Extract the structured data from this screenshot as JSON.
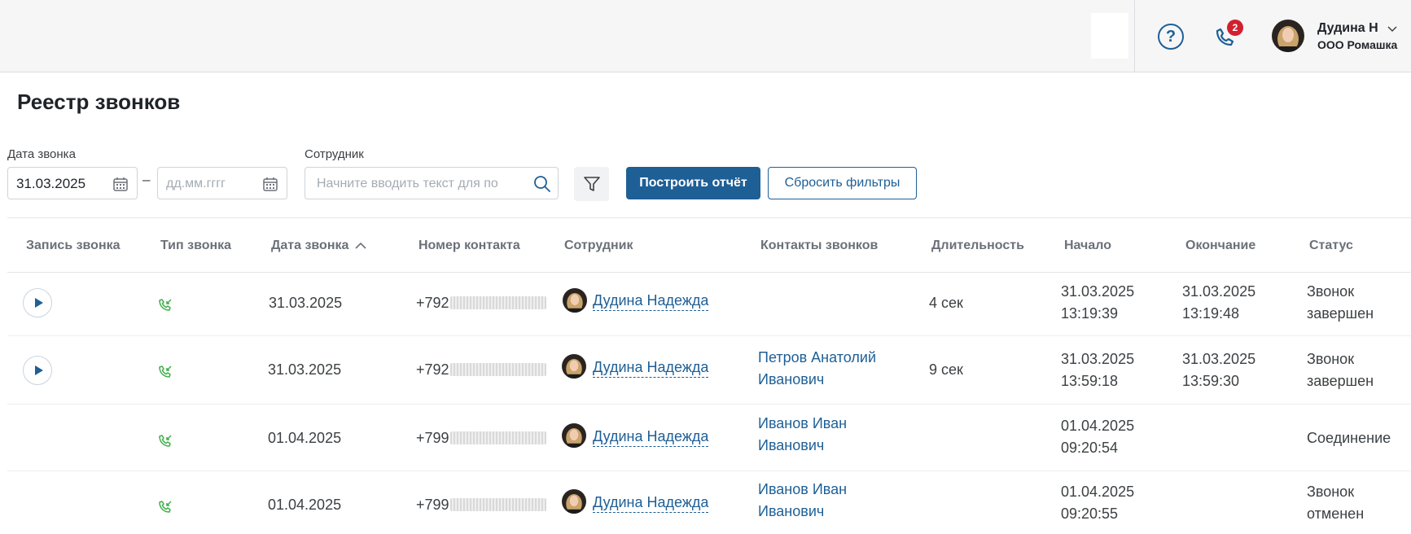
{
  "header": {
    "help_label": "?",
    "notifications_count": "2",
    "user_name": "Дудина Н",
    "user_org": "ООО Ромашка"
  },
  "page": {
    "title": "Реестр звонков"
  },
  "filters": {
    "date_label": "Дата звонка",
    "date_from": "31.03.2025",
    "date_to_placeholder": "дд.мм.гггг",
    "date_separator": "–",
    "employee_label": "Сотрудник",
    "employee_placeholder": "Начните вводить текст для по",
    "build_report": "Построить отчёт",
    "reset_filters": "Сбросить фильтры"
  },
  "table": {
    "columns": [
      "Запись звонка",
      "Тип звонка",
      "Дата звонка",
      "Номер контакта",
      "Сотрудник",
      "Контакты звонков",
      "Длительность",
      "Начало",
      "Окончание",
      "Статус"
    ],
    "rows": [
      {
        "has_record": true,
        "date": "31.03.2025",
        "phone_prefix": "+792",
        "employee": "Дудина Надежда",
        "contact_line1": "",
        "contact_line2": "",
        "duration": "4 сек",
        "start_date": "31.03.2025",
        "start_time": "13:19:39",
        "end_date": "31.03.2025",
        "end_time": "13:19:48",
        "status_line1": "Звонок",
        "status_line2": "завершен"
      },
      {
        "has_record": true,
        "date": "31.03.2025",
        "phone_prefix": "+792",
        "employee": "Дудина Надежда",
        "contact_line1": "Петров Анатолий",
        "contact_line2": "Иванович",
        "duration": "9 сек",
        "start_date": "31.03.2025",
        "start_time": "13:59:18",
        "end_date": "31.03.2025",
        "end_time": "13:59:30",
        "status_line1": "Звонок",
        "status_line2": "завершен"
      },
      {
        "has_record": false,
        "date": "01.04.2025",
        "phone_prefix": "+799",
        "employee": "Дудина Надежда",
        "contact_line1": "Иванов Иван",
        "contact_line2": "Иванович",
        "duration": "",
        "start_date": "01.04.2025",
        "start_time": "09:20:54",
        "end_date": "",
        "end_time": "",
        "status_line1": "Соединение",
        "status_line2": ""
      },
      {
        "has_record": false,
        "date": "01.04.2025",
        "phone_prefix": "+799",
        "employee": "Дудина Надежда",
        "contact_line1": "Иванов Иван",
        "contact_line2": "Иванович",
        "duration": "",
        "start_date": "01.04.2025",
        "start_time": "09:20:55",
        "end_date": "",
        "end_time": "",
        "status_line1": "Звонок",
        "status_line2": "отменен"
      }
    ]
  },
  "icons": {
    "help": "question-circle-icon",
    "phone": "phone-icon",
    "chevron": "chevron-down-icon",
    "calendar": "calendar-icon",
    "search": "search-icon",
    "filter": "funnel-icon",
    "sort": "sort-asc-icon",
    "play": "play-icon",
    "call_type": "incoming-call-icon"
  },
  "colors": {
    "accent": "#1e5f96",
    "badge": "#d2202f",
    "call_type": "#3fae4a",
    "header_bg": "#f6f6f6"
  }
}
